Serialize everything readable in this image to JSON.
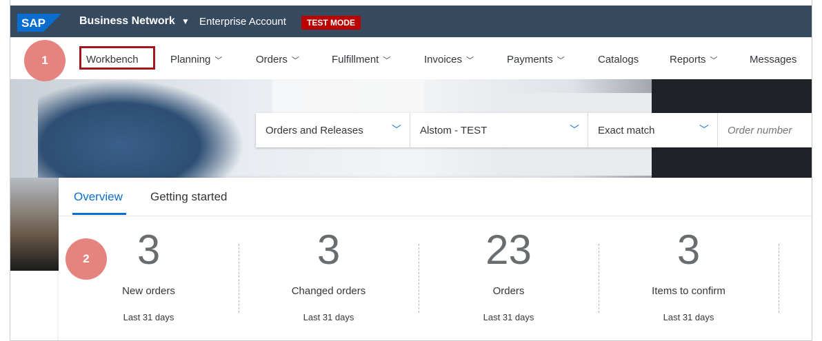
{
  "shell": {
    "logo_text": "SAP",
    "brand": "Business Network",
    "account": "Enterprise Account",
    "test_badge": "TEST MODE",
    "colors": {
      "shell_bg": "#354a5f",
      "badge_bg": "#bb0000",
      "accent": "#0a6ed1",
      "step_badge": "#e5837f",
      "highlight_border": "#a4151e"
    }
  },
  "nav": {
    "items": [
      {
        "label": "Workbench",
        "has_menu": false
      },
      {
        "label": "Planning",
        "has_menu": true
      },
      {
        "label": "Orders",
        "has_menu": true
      },
      {
        "label": "Fulfillment",
        "has_menu": true
      },
      {
        "label": "Invoices",
        "has_menu": true
      },
      {
        "label": "Payments",
        "has_menu": true
      },
      {
        "label": "Catalogs",
        "has_menu": false
      },
      {
        "label": "Reports",
        "has_menu": true
      },
      {
        "label": "Messages",
        "has_menu": false
      }
    ]
  },
  "search": {
    "document_type": "Orders and Releases",
    "customer": "Alstom - TEST",
    "match_type": "Exact match",
    "placeholder": "Order number"
  },
  "tabs": [
    {
      "label": "Overview",
      "active": true
    },
    {
      "label": "Getting started",
      "active": false
    }
  ],
  "tiles": [
    {
      "value": "3",
      "label": "New orders",
      "period": "Last 31 days"
    },
    {
      "value": "3",
      "label": "Changed orders",
      "period": "Last 31 days"
    },
    {
      "value": "23",
      "label": "Orders",
      "period": "Last 31 days"
    },
    {
      "value": "3",
      "label": "Items to confirm",
      "period": "Last 31 days"
    }
  ],
  "steps": [
    {
      "number": "1"
    },
    {
      "number": "2"
    }
  ]
}
